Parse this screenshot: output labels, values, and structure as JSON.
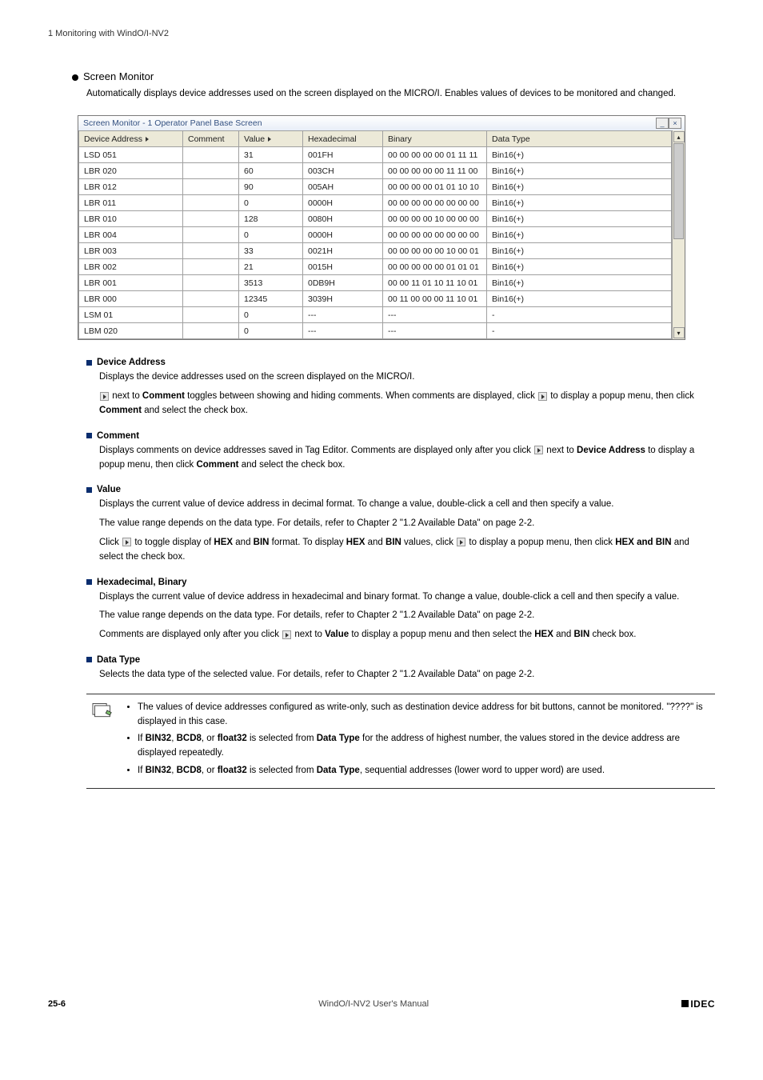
{
  "header_line": "1 Monitoring with WindO/I-NV2",
  "section_title": "Screen Monitor",
  "section_desc": "Automatically displays device addresses used on the screen displayed on the MICRO/I. Enables values of devices to be monitored and changed.",
  "window_title": "Screen Monitor - 1 Operator Panel Base Screen",
  "cols": {
    "addr": "Device Address",
    "comment": "Comment",
    "value": "Value",
    "hex": "Hexadecimal",
    "bin": "Binary",
    "dtype": "Data Type"
  },
  "rows": [
    {
      "addr": "LSD 051",
      "val": "31",
      "hex": "001FH",
      "bin": "00 00 00 00 00 01 11 11",
      "dt": "Bin16(+)"
    },
    {
      "addr": "LBR 020",
      "val": "60",
      "hex": "003CH",
      "bin": "00 00 00 00 00 11 11 00",
      "dt": "Bin16(+)"
    },
    {
      "addr": "LBR 012",
      "val": "90",
      "hex": "005AH",
      "bin": "00 00 00 00 01 01 10 10",
      "dt": "Bin16(+)"
    },
    {
      "addr": "LBR 011",
      "val": "0",
      "hex": "0000H",
      "bin": "00 00 00 00 00 00 00 00",
      "dt": "Bin16(+)"
    },
    {
      "addr": "LBR 010",
      "val": "128",
      "hex": "0080H",
      "bin": "00 00 00 00 10 00 00 00",
      "dt": "Bin16(+)"
    },
    {
      "addr": "LBR 004",
      "val": "0",
      "hex": "0000H",
      "bin": "00 00 00 00 00 00 00 00",
      "dt": "Bin16(+)"
    },
    {
      "addr": "LBR 003",
      "val": "33",
      "hex": "0021H",
      "bin": "00 00 00 00 00 10 00 01",
      "dt": "Bin16(+)"
    },
    {
      "addr": "LBR 002",
      "val": "21",
      "hex": "0015H",
      "bin": "00 00 00 00 00 01 01 01",
      "dt": "Bin16(+)"
    },
    {
      "addr": "LBR 001",
      "val": "3513",
      "hex": "0DB9H",
      "bin": "00 00 11 01 10 11 10 01",
      "dt": "Bin16(+)"
    },
    {
      "addr": "LBR 000",
      "val": "12345",
      "hex": "3039H",
      "bin": "00 11 00 00 00 11 10 01",
      "dt": "Bin16(+)"
    },
    {
      "addr": "LSM 01",
      "val": "0",
      "hex": "---",
      "bin": "---",
      "dt": "-"
    },
    {
      "addr": "LBM 020",
      "val": "0",
      "hex": "---",
      "bin": "---",
      "dt": "-"
    }
  ],
  "defs": {
    "d1_title": "Device Address",
    "d1_p1": "Displays the device addresses used on the screen displayed on the MICRO/I.",
    "d1_p2a": "next to ",
    "d1_p2b": "Comment",
    "d1_p2c": " toggles between showing and hiding comments. When comments are displayed, click ",
    "d1_p2d": " to display a popup menu, then click ",
    "d1_p2e": "Comment",
    "d1_p2f": " and select the check box.",
    "d2_title": "Comment",
    "d2_p1a": "Displays comments on device addresses saved in Tag Editor. Comments are displayed only after you click ",
    "d2_p1b": " next to ",
    "d2_p1c": "Device Address",
    "d2_p1d": " to display a popup menu, then click ",
    "d2_p1e": "Comment",
    "d2_p1f": " and select the check box.",
    "d3_title": "Value",
    "d3_p1": "Displays the current value of device address in decimal format. To change a value, double-click a cell and then specify a value.",
    "d3_p2": "The value range depends on the data type. For details, refer to Chapter 2 \"1.2 Available Data\" on page 2-2.",
    "d3_p3a": "Click ",
    "d3_p3b": " to toggle display of ",
    "d3_p3c": "HEX",
    "d3_p3d": " and ",
    "d3_p3e": "BIN",
    "d3_p3f": " format. To display ",
    "d3_p3g": "HEX",
    "d3_p3h": " and ",
    "d3_p3i": "BIN",
    "d3_p3j": " values, click ",
    "d3_p3k": " to display a popup menu, then click ",
    "d3_p3l": "HEX and BIN",
    "d3_p3m": " and select the check box.",
    "d4_title": "Hexadecimal, Binary",
    "d4_p1": "Displays the current value of device address in hexadecimal and binary format. To change a value, double-click a cell and then specify a value.",
    "d4_p2": "The value range depends on the data type. For details, refer to Chapter 2 \"1.2 Available Data\" on page 2-2.",
    "d4_p3a": "Comments are displayed only after you click ",
    "d4_p3b": " next to ",
    "d4_p3c": "Value",
    "d4_p3d": " to display a popup menu and then select the ",
    "d4_p3e": "HEX",
    "d4_p3f": " and ",
    "d4_p3g": "BIN",
    "d4_p3h": " check box.",
    "d5_title": "Data Type",
    "d5_p1": "Selects the data type of the selected value. For details, refer to Chapter 2 \"1.2 Available Data\" on page 2-2."
  },
  "notes": {
    "n1": "The values of device addresses configured as write-only, such as destination device address for bit buttons, cannot be monitored. \"????\" is displayed in this case.",
    "n2a": "If ",
    "n2b": "BIN32",
    "n2c": ", ",
    "n2d": "BCD8",
    "n2e": ", or ",
    "n2f": "float32",
    "n2g": " is selected from ",
    "n2h": "Data Type",
    "n2i": " for the address of highest number, the values stored in the device address are displayed repeatedly.",
    "n3a": "If ",
    "n3b": "BIN32",
    "n3c": ", ",
    "n3d": "BCD8",
    "n3e": ", or ",
    "n3f": "float32",
    "n3g": " is selected from ",
    "n3h": "Data Type",
    "n3i": ", sequential addresses (lower word to upper word) are used."
  },
  "footer": {
    "page": "25-6",
    "mid": "WindO/I-NV2 User's Manual",
    "brand": "IDEC"
  }
}
